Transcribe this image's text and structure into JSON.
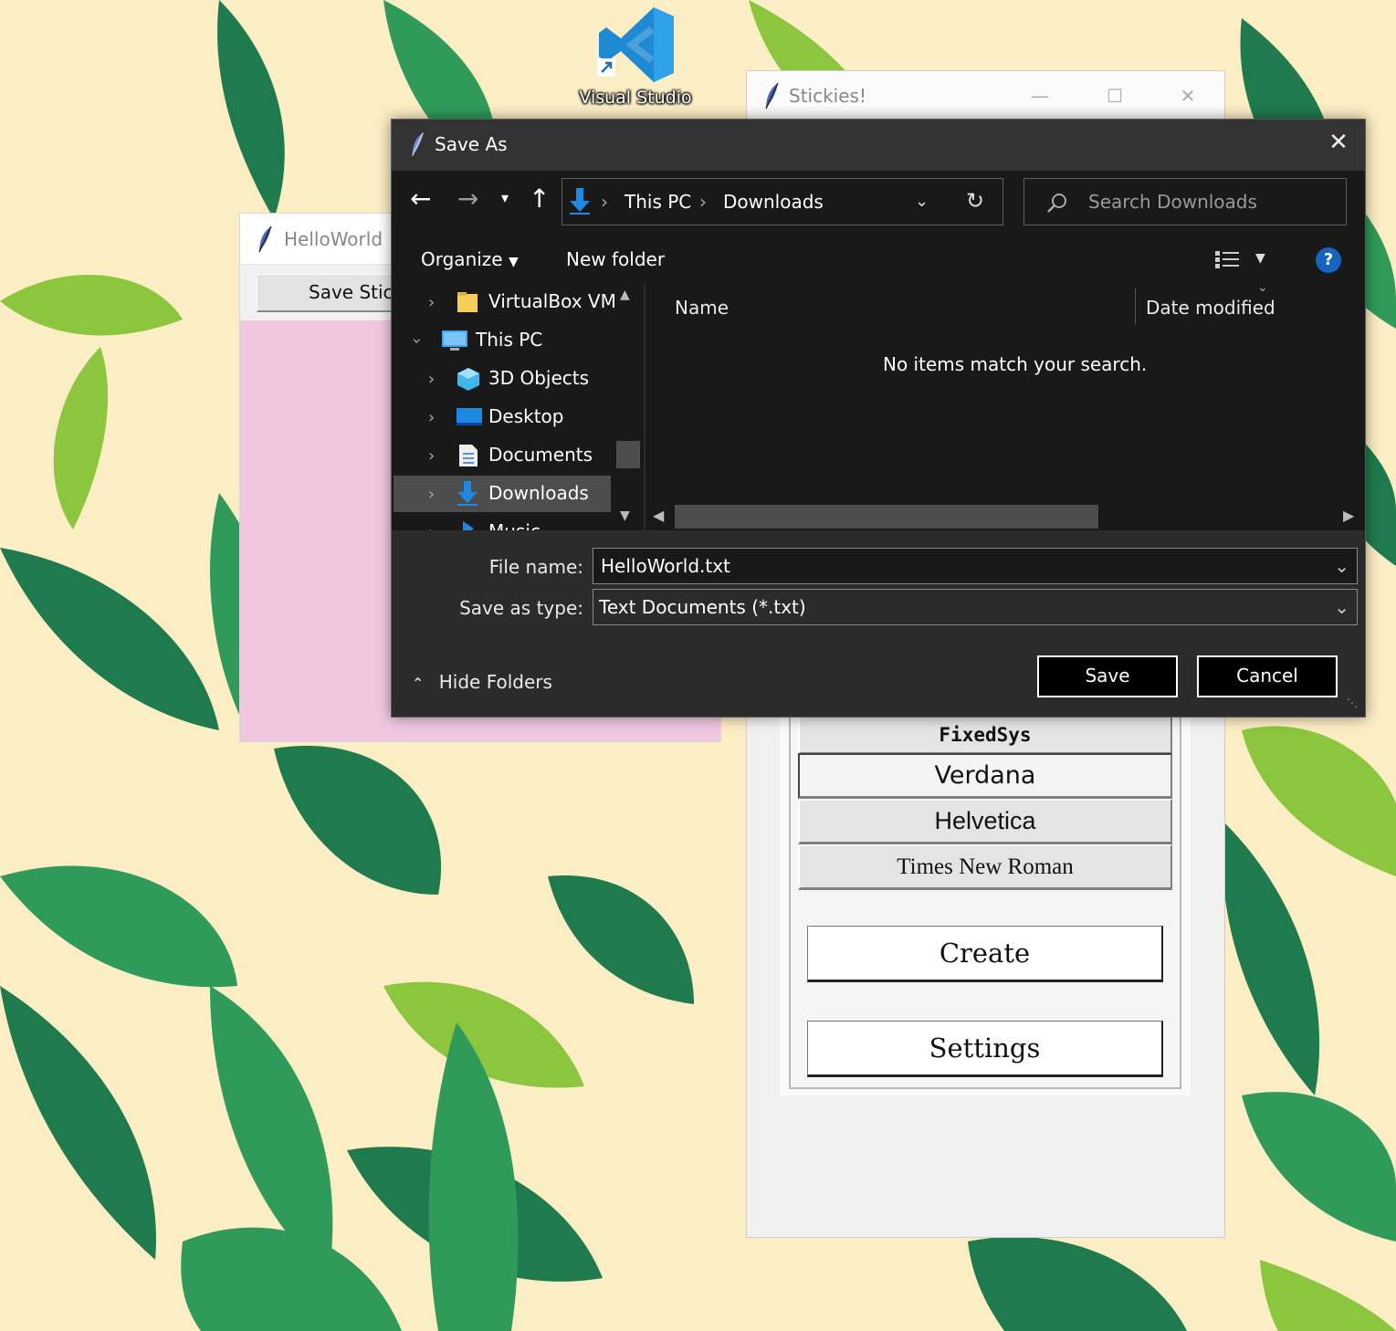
{
  "desktop": {
    "icon_label": "Visual Studio",
    "icon_name": "vscode-icon"
  },
  "stickies_window": {
    "title": "Stickies!",
    "controls": {
      "minimize": "—",
      "maximize": "☐",
      "close": "✕"
    },
    "fonts": [
      "FixedSys",
      "Verdana",
      "Helvetica",
      "Times New Roman"
    ],
    "create_label": "Create",
    "settings_label": "Settings"
  },
  "hello_window": {
    "title": "HelloWorld",
    "save_button": "Save Stick"
  },
  "save_dialog": {
    "title": "Save As",
    "close": "✕",
    "breadcrumb": [
      "This PC",
      "Downloads"
    ],
    "search_placeholder": "Search Downloads",
    "organize_label": "Organize",
    "new_folder_label": "New folder",
    "help": "?",
    "tree": [
      "VirtualBox VMs",
      "This PC",
      "3D Objects",
      "Desktop",
      "Documents",
      "Downloads",
      "Music"
    ],
    "columns": {
      "name": "Name",
      "date_modified": "Date modified"
    },
    "empty_message": "No items match your search.",
    "file_name_label": "File name:",
    "file_name_value": "HelloWorld.txt",
    "save_type_label": "Save as type:",
    "save_type_value": "Text Documents (*.txt)",
    "hide_folders_label": "Hide Folders",
    "save_label": "Save",
    "cancel_label": "Cancel"
  },
  "colors": {
    "wallpaper_bg": "#fbedc4",
    "leaf_dark": "#1f7a4d",
    "leaf_light": "#8cc63f",
    "sticky_note": "#f0c7df",
    "dialog_bg": "#2b2b2b",
    "accent_blue": "#1e88e5"
  }
}
